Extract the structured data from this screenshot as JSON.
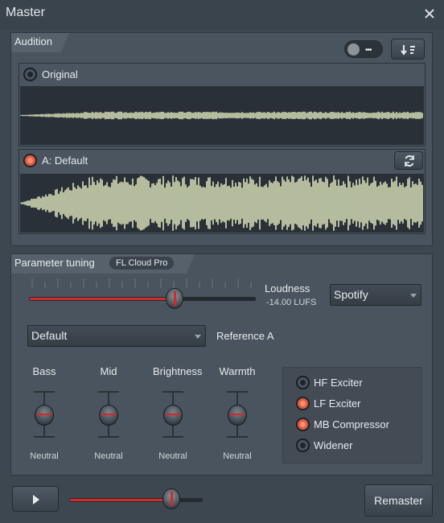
{
  "window": {
    "title": "Master",
    "close_icon": "close-icon"
  },
  "audition": {
    "header": "Audition",
    "toggle_icon": "toggle-options-icon",
    "sort_icon": "sort-download-icon",
    "original": {
      "label": "Original",
      "active": false
    },
    "variant": {
      "label": "A: Default",
      "active": true,
      "refresh_icon": "refresh-icon"
    }
  },
  "tuning": {
    "header": "Parameter tuning",
    "badge": "FL Cloud Pro",
    "loudness": {
      "label": "Loudness",
      "value": "-14.00 LUFS",
      "level": 0.6
    },
    "platform": {
      "selected": "Spotify"
    },
    "preset": {
      "selected": "Default"
    },
    "reference": "Reference A",
    "knobs": [
      {
        "label": "Bass",
        "value": "Neutral"
      },
      {
        "label": "Mid",
        "value": "Neutral"
      },
      {
        "label": "Brightness",
        "value": "Neutral"
      },
      {
        "label": "Warmth",
        "value": "Neutral"
      }
    ],
    "effects": [
      {
        "label": "HF Exciter",
        "on": false
      },
      {
        "label": "LF Exciter",
        "on": true
      },
      {
        "label": "MB Compressor",
        "on": true
      },
      {
        "label": "Widener",
        "on": false
      }
    ]
  },
  "footer": {
    "play_icon": "play-icon",
    "volume_level": 0.76,
    "remaster_label": "Remaster"
  },
  "colors": {
    "accent_red": "#d42a2a",
    "led_on": "#e25a3f",
    "wave": "#d8e0b8",
    "panel": "#4a545e",
    "background": "#3d4750"
  }
}
